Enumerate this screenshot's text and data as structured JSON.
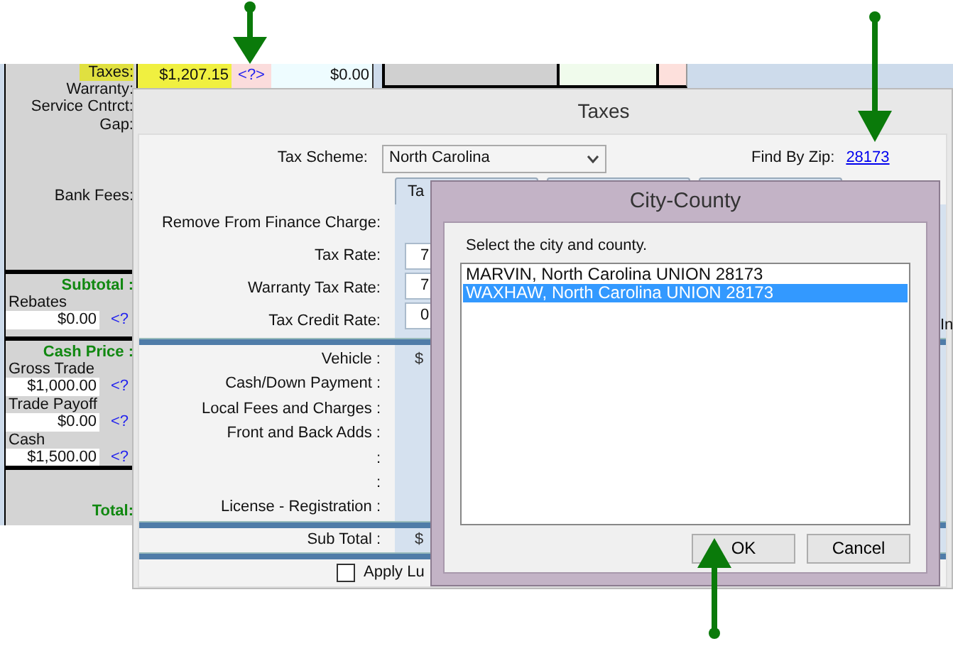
{
  "top_strip": {
    "taxes_amount": "$1,207.15",
    "lookup": "<?>",
    "second_amount": "$0.00"
  },
  "side_panel": {
    "labels": [
      "Taxes:",
      "Warranty:",
      "Service Cntrct:",
      "Gap:"
    ],
    "bank_fees": "Bank Fees:",
    "subtotal": "Subtotal :",
    "rebates": {
      "label": "Rebates",
      "value": "$0.00",
      "lookup": "<?"
    },
    "cash_price": "Cash Price :",
    "trade_fields": [
      {
        "label": "Gross Trade",
        "value": "$1,000.00",
        "lookup": "<?"
      },
      {
        "label": "Trade Payoff",
        "value": "$0.00",
        "lookup": "<?"
      },
      {
        "label": "Cash",
        "value": "$1,500.00",
        "lookup": "<?"
      }
    ],
    "total": "Total:"
  },
  "taxes_dialog": {
    "title": "Taxes",
    "tax_scheme": {
      "label": "Tax Scheme:",
      "value": "North Carolina"
    },
    "find_by_zip": {
      "label": "Find By Zip:",
      "link": "28173"
    },
    "tabs": [
      {
        "kind": "labelled",
        "label": "Ta"
      },
      {
        "kind": "covered"
      },
      {
        "kind": "covered"
      }
    ],
    "remove_label": "Remove From Finance Charge:",
    "rates": [
      {
        "label": "Tax Rate:",
        "value": "7"
      },
      {
        "label": "Warranty Tax Rate:",
        "value": "7"
      },
      {
        "label": "Tax Credit Rate:",
        "value": "0"
      }
    ],
    "side_text": "In",
    "breakdown": [
      {
        "label": "Vehicle :",
        "value": "$"
      },
      {
        "label": "Cash/Down Payment :"
      },
      {
        "label": "Local Fees and Charges :"
      },
      {
        "label": "Front and Back Adds :"
      },
      {
        "label": ":"
      },
      {
        "label": ":"
      },
      {
        "label": "License - Registration :"
      }
    ],
    "sub_total": {
      "label": "Sub Total :",
      "value": "$"
    },
    "luxury": {
      "label": "Apply Lu",
      "checked": false
    }
  },
  "city_county_dialog": {
    "title": "City-County",
    "prompt": "Select the city and county.",
    "items": [
      {
        "text": "MARVIN, North Carolina UNION 28173",
        "selected": false
      },
      {
        "text": "WAXHAW, North Carolina UNION 28173",
        "selected": true
      }
    ],
    "buttons": [
      "OK",
      "Cancel"
    ]
  }
}
